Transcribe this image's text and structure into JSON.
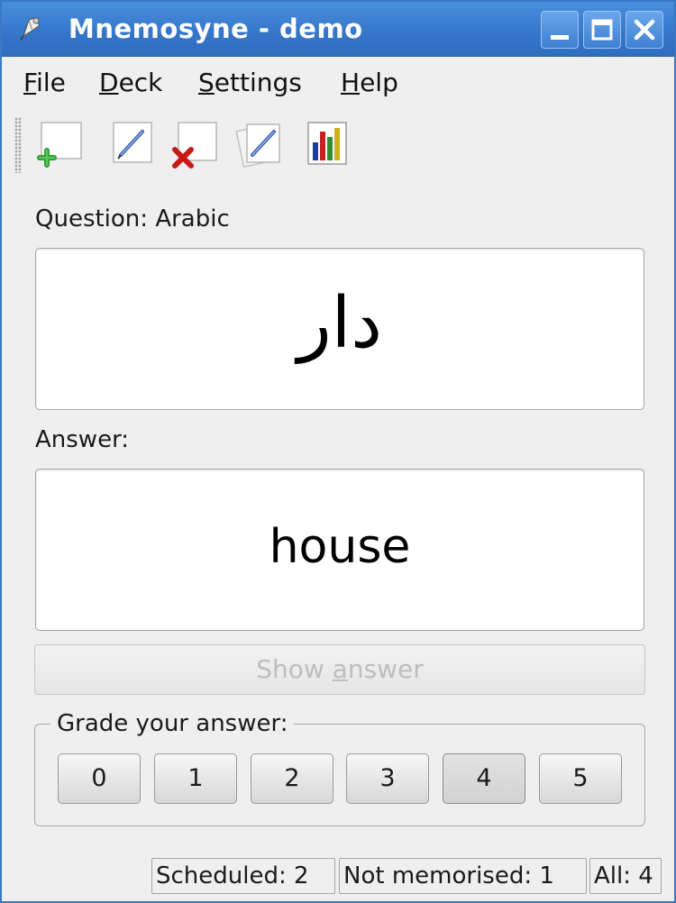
{
  "window": {
    "title": "Mnemosyne - demo",
    "titlebar_color": "#3677c9"
  },
  "menu": {
    "file": {
      "u": "F",
      "rest": "ile"
    },
    "deck": {
      "u": "D",
      "rest": "eck"
    },
    "settings": {
      "u": "S",
      "rest": "ettings"
    },
    "help": {
      "u": "H",
      "rest": "elp"
    }
  },
  "toolbar": {
    "icons": [
      "add-card-icon",
      "edit-card-icon",
      "delete-card-icon",
      "edit-deck-icon",
      "statistics-icon"
    ]
  },
  "question": {
    "label": "Question: Arabic",
    "text": "دار"
  },
  "answer": {
    "label": "Answer:",
    "text": "house"
  },
  "show_answer": {
    "before": "Show ",
    "underlined": "a",
    "after": "nswer",
    "enabled": false
  },
  "grade": {
    "title": "Grade your answer:",
    "buttons": [
      "0",
      "1",
      "2",
      "3",
      "4",
      "5"
    ],
    "highlighted": "4"
  },
  "status": {
    "scheduled": "Scheduled: 2",
    "not_memorised": "Not memorised: 1",
    "all": "All: 4"
  }
}
